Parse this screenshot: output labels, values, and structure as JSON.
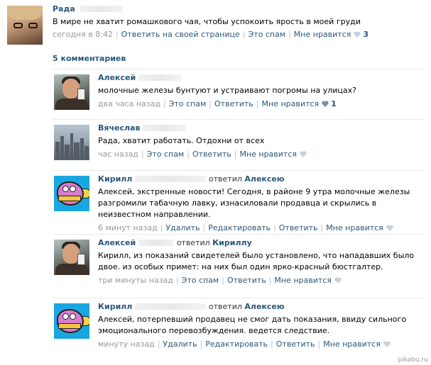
{
  "post": {
    "author": "Рада",
    "text": "В мире не хватит ромашкового чая, чтобы успокоить ярость в моей груди",
    "time": "сегодня в 8:42",
    "reply_link": "Ответить на своей странице",
    "spam_link": "Это спам",
    "like_link": "Мне нравится",
    "like_count": "3"
  },
  "comments_header": "5 комментариев",
  "comments": [
    {
      "author": "Алексей",
      "replied_label": "",
      "reply_to": "",
      "text": "молочные железы бунтуют и устраивают погромы на улицах?",
      "time": "два часа назад",
      "actions": [
        "Это спам",
        "Ответить",
        "Мне нравится"
      ],
      "like_count": "1"
    },
    {
      "author": "Вячеслав",
      "replied_label": "",
      "reply_to": "",
      "text": "Рада, хватит работать. Отдохни от всех",
      "time": "час назад",
      "actions": [
        "Это спам",
        "Ответить",
        "Мне нравится"
      ],
      "like_count": ""
    },
    {
      "author": "Кирилл",
      "replied_label": "ответил",
      "reply_to": "Алексею",
      "text": "Алексей, экстренные новости! Сегодня, в районе 9 утра молочные железы разгромили табачную лавку, изнасиловали продавца и скрылись в неизвестном направлении.",
      "time": "6 минут назад",
      "actions": [
        "Удалить",
        "Редактировать",
        "Ответить",
        "Мне нравится"
      ],
      "like_count": ""
    },
    {
      "author": "Алексей",
      "replied_label": "ответил",
      "reply_to": "Кириллу",
      "text": "Кирилл, из показаний свидетелей было установлено, что нападавших было двое. из особых примет: на них был один ярко-красный бюстгалтер.",
      "time": "три минуты назад",
      "actions": [
        "Это спам",
        "Ответить",
        "Мне нравится"
      ],
      "like_count": ""
    },
    {
      "author": "Кирилл",
      "replied_label": "ответил",
      "reply_to": "Алексею",
      "text": "Алексей, потерпевший продавец не смог дать показания, ввиду сильного эмоционального перевозбуждения. ведется следствие.",
      "time": "минуту назад",
      "actions": [
        "Удалить",
        "Редактировать",
        "Ответить",
        "Мне нравится"
      ],
      "like_count": ""
    }
  ],
  "watermark": "pikabu.ru",
  "colors": {
    "link": "#2b587a",
    "meta": "#999999",
    "heart_active": "#6d8fb3",
    "heart_inactive": "#c5d2df"
  }
}
